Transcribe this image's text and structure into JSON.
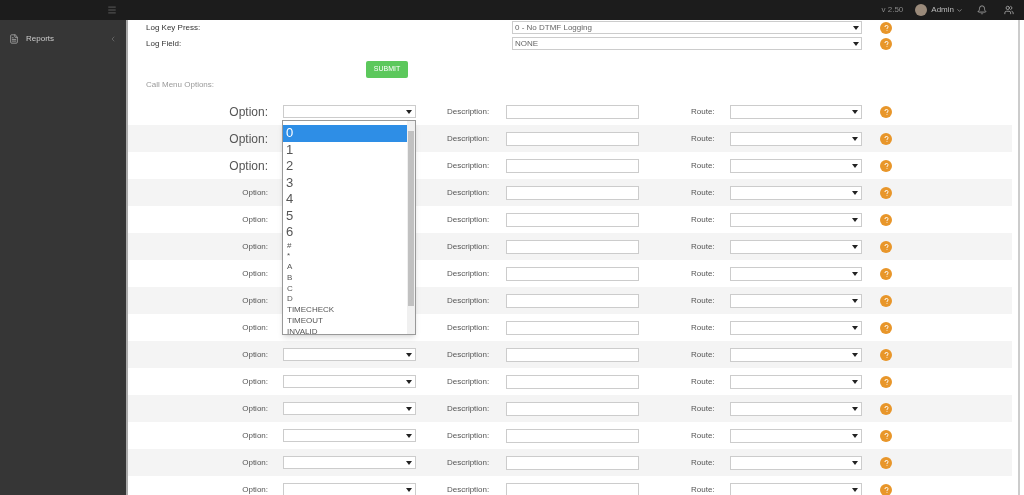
{
  "topbar": {
    "version": "v 2.50",
    "user": "Admin"
  },
  "sidebar": {
    "items": [
      {
        "label": "Reports"
      }
    ]
  },
  "settings": [
    {
      "label": "Log Key Press:",
      "value": "0 - No DTMF Logging"
    },
    {
      "label": "Log Field:",
      "value": "NONE"
    }
  ],
  "submit": "SUBMIT",
  "section_title": "Call Menu Options:",
  "rows": [
    {
      "option_label": "Option:",
      "magnified": true,
      "description_label": "Description:",
      "route_label": "Route:"
    },
    {
      "option_label": "Option:",
      "magnified": true,
      "description_label": "Description:",
      "route_label": "Route:"
    },
    {
      "option_label": "Option:",
      "magnified": true,
      "description_label": "Description:",
      "route_label": "Route:"
    },
    {
      "option_label": "Option:",
      "magnified": false,
      "description_label": "Description:",
      "route_label": "Route:"
    },
    {
      "option_label": "Option:",
      "magnified": false,
      "description_label": "Description:",
      "route_label": "Route:"
    },
    {
      "option_label": "Option:",
      "magnified": false,
      "description_label": "Description:",
      "route_label": "Route:"
    },
    {
      "option_label": "Option:",
      "magnified": false,
      "description_label": "Description:",
      "route_label": "Route:"
    },
    {
      "option_label": "Option:",
      "magnified": false,
      "description_label": "Description:",
      "route_label": "Route:"
    },
    {
      "option_label": "Option:",
      "magnified": false,
      "description_label": "Description:",
      "route_label": "Route:"
    },
    {
      "option_label": "Option:",
      "magnified": false,
      "description_label": "Description:",
      "route_label": "Route:"
    },
    {
      "option_label": "Option:",
      "magnified": false,
      "description_label": "Description:",
      "route_label": "Route:"
    },
    {
      "option_label": "Option:",
      "magnified": false,
      "description_label": "Description:",
      "route_label": "Route:"
    },
    {
      "option_label": "Option:",
      "magnified": false,
      "description_label": "Description:",
      "route_label": "Route:"
    },
    {
      "option_label": "Option:",
      "magnified": false,
      "description_label": "Description:",
      "route_label": "Route:"
    },
    {
      "option_label": "Option:",
      "magnified": false,
      "description_label": "Description:",
      "route_label": "Route:"
    }
  ],
  "option_dropdown": {
    "items": [
      {
        "label": "0",
        "kind": "large",
        "selected": true
      },
      {
        "label": "1",
        "kind": "large",
        "selected": false
      },
      {
        "label": "2",
        "kind": "large",
        "selected": false
      },
      {
        "label": "3",
        "kind": "large",
        "selected": false
      },
      {
        "label": "4",
        "kind": "large",
        "selected": false
      },
      {
        "label": "5",
        "kind": "large",
        "selected": false
      },
      {
        "label": "6",
        "kind": "large",
        "selected": false
      },
      {
        "label": "#",
        "kind": "small",
        "selected": false
      },
      {
        "label": "*",
        "kind": "small",
        "selected": false
      },
      {
        "label": "A",
        "kind": "small",
        "selected": false
      },
      {
        "label": "B",
        "kind": "small",
        "selected": false
      },
      {
        "label": "C",
        "kind": "small",
        "selected": false
      },
      {
        "label": "D",
        "kind": "small",
        "selected": false
      },
      {
        "label": "TIMECHECK",
        "kind": "small",
        "selected": false
      },
      {
        "label": "TIMEOUT",
        "kind": "small",
        "selected": false
      },
      {
        "label": "INVALID",
        "kind": "small",
        "selected": false
      }
    ]
  }
}
